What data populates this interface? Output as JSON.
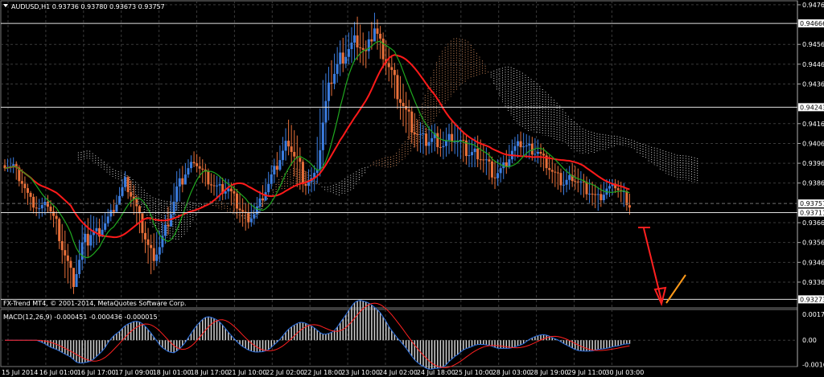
{
  "window": {
    "symbol_caption": "AUDUSD,H1  0.93736 0.93780 0.93673 0.93757",
    "copyright": "FX-Trend MT4, © 2001-2014, MetaQuotes Software Corp."
  },
  "colors": {
    "background": "#000000",
    "grid": "#3a3a3a",
    "bull_candle": "#3b7de0",
    "bear_candle": "#e8703a",
    "ma_red": "#ff1a1a",
    "ma_green": "#1fa81f",
    "cloud_bull": "#d08a5c",
    "cloud_bear": "#d8d8d8",
    "macd_main": "#2c6fe0",
    "macd_signal": "#ff2020",
    "macd_hist": "#d0d0d0",
    "arrow_down": "#ff2020",
    "arrow_up": "#ff9a1a",
    "fractal_up": "#22dd22",
    "fractal_down": "#ff2020"
  },
  "chart_data": [
    {
      "type": "candlestick",
      "symbol": "AUDUSD",
      "timeframe": "H1",
      "ylim": [
        0.9323,
        0.9478
      ],
      "y_ticks": [
        "0.94760",
        "0.94560",
        "0.94460",
        "0.94360",
        "0.94160",
        "0.94060",
        "0.93960",
        "0.93860",
        "0.93660",
        "0.93560",
        "0.93460",
        "0.93360"
      ],
      "x_ticks": [
        "15 Jul 2014",
        "16 Jul 01:00",
        "16 Jul 17:00",
        "17 Jul 09:00",
        "18 Jul 01:00",
        "18 Jul 17:00",
        "21 Jul 10:00",
        "22 Jul 02:00",
        "22 Jul 18:00",
        "23 Jul 10:00",
        "24 Jul 02:00",
        "24 Jul 18:00",
        "25 Jul 10:00",
        "28 Jul 03:00",
        "28 Jul 19:00",
        "29 Jul 11:00",
        "30 Jul 03:00"
      ],
      "price_levels": [
        {
          "label": "0.94666",
          "value": 0.94666,
          "style": "line"
        },
        {
          "label": "0.94243",
          "value": 0.94243,
          "style": "line"
        },
        {
          "label": "0.93757",
          "value": 0.93757,
          "style": "box"
        },
        {
          "label": "0.93711",
          "value": 0.93711,
          "style": "line"
        },
        {
          "label": "0.93273",
          "value": 0.93273,
          "style": "line"
        }
      ],
      "price_path": [
        [
          0.9392,
          0.9398
        ],
        [
          0.9391,
          0.9399
        ],
        [
          0.9381,
          0.9393
        ],
        [
          0.9372,
          0.9382
        ],
        [
          0.9368,
          0.9378
        ],
        [
          0.9371,
          0.938
        ],
        [
          0.936,
          0.9372
        ],
        [
          0.9338,
          0.9362
        ],
        [
          0.933,
          0.9342
        ],
        [
          0.9342,
          0.9365
        ],
        [
          0.9352,
          0.937
        ],
        [
          0.9356,
          0.9368
        ],
        [
          0.9364,
          0.9373
        ],
        [
          0.9372,
          0.938
        ],
        [
          0.9382,
          0.9392
        ],
        [
          0.937,
          0.9385
        ],
        [
          0.9356,
          0.937
        ],
        [
          0.934,
          0.936
        ],
        [
          0.9346,
          0.9362
        ],
        [
          0.936,
          0.9374
        ],
        [
          0.9372,
          0.9392
        ],
        [
          0.9386,
          0.9396
        ],
        [
          0.9394,
          0.9402
        ],
        [
          0.9386,
          0.9398
        ],
        [
          0.9381,
          0.9391
        ],
        [
          0.9377,
          0.9389
        ],
        [
          0.9378,
          0.9388
        ],
        [
          0.9368,
          0.9383
        ],
        [
          0.9362,
          0.9376
        ],
        [
          0.9365,
          0.9376
        ],
        [
          0.9374,
          0.9385
        ],
        [
          0.9383,
          0.9395
        ],
        [
          0.9392,
          0.9405
        ],
        [
          0.94,
          0.9418
        ],
        [
          0.9384,
          0.941
        ],
        [
          0.938,
          0.9392
        ],
        [
          0.9382,
          0.9395
        ],
        [
          0.9393,
          0.9438
        ],
        [
          0.943,
          0.9448
        ],
        [
          0.944,
          0.9458
        ],
        [
          0.9446,
          0.9462
        ],
        [
          0.9448,
          0.947
        ],
        [
          0.9444,
          0.9458
        ],
        [
          0.9458,
          0.9472
        ],
        [
          0.9444,
          0.9462
        ],
        [
          0.9434,
          0.945
        ],
        [
          0.9418,
          0.944
        ],
        [
          0.9408,
          0.9428
        ],
        [
          0.9402,
          0.9418
        ],
        [
          0.94,
          0.9414
        ],
        [
          0.9402,
          0.9416
        ],
        [
          0.9398,
          0.9412
        ],
        [
          0.9402,
          0.9418
        ],
        [
          0.9398,
          0.9414
        ],
        [
          0.9394,
          0.9408
        ],
        [
          0.9394,
          0.941
        ],
        [
          0.939,
          0.9404
        ],
        [
          0.9383,
          0.9397
        ],
        [
          0.9388,
          0.94
        ],
        [
          0.9396,
          0.9408
        ],
        [
          0.94,
          0.9412
        ],
        [
          0.9398,
          0.941
        ],
        [
          0.9396,
          0.9408
        ],
        [
          0.939,
          0.9402
        ],
        [
          0.9384,
          0.9396
        ],
        [
          0.938,
          0.9392
        ],
        [
          0.9384,
          0.9396
        ],
        [
          0.938,
          0.9392
        ],
        [
          0.9376,
          0.9388
        ],
        [
          0.9372,
          0.9384
        ],
        [
          0.9378,
          0.9388
        ],
        [
          0.9381,
          0.9388
        ],
        [
          0.9374,
          0.9386
        ],
        [
          0.9368,
          0.9378
        ]
      ],
      "price_path_columns": [
        "low",
        "high"
      ],
      "indicators": [
        "Ichimoku cloud",
        "moving average (red)",
        "moving average (green)",
        "trend lines",
        "forecast arrow"
      ]
    },
    {
      "type": "macd",
      "label": "MACD(12,26,9) -0.000451 -0.000436 -0.000015",
      "ylim": [
        -0.0018,
        0.0021
      ],
      "y_ticks": [
        "0.00176",
        "0.00",
        "-0.00165"
      ]
    }
  ]
}
